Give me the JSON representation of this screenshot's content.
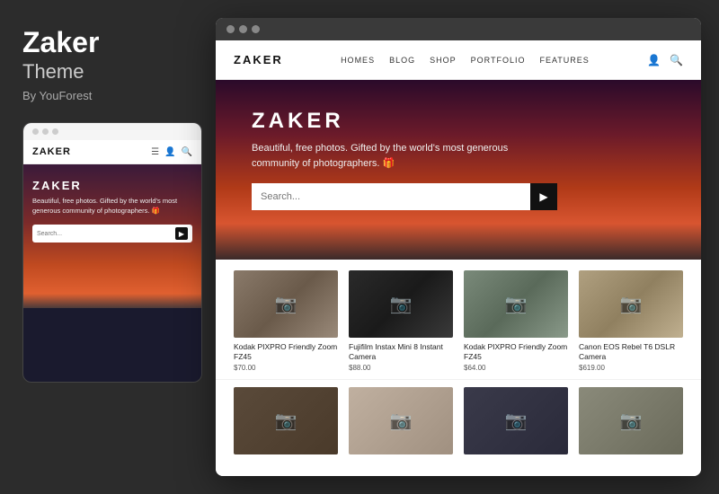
{
  "leftPanel": {
    "title": "Zaker",
    "subtitle": "Theme",
    "author": "By YouForest"
  },
  "mobileDots": [
    "dot1",
    "dot2",
    "dot3"
  ],
  "mobileNav": {
    "logo": "ZAKER",
    "icons": [
      "☰",
      "👤",
      "🔍"
    ]
  },
  "mobileHero": {
    "title": "ZAKER",
    "description": "Beautiful, free photos. Gifted by the world's most generous community of photographers. 🎁",
    "searchPlaceholder": "Search..."
  },
  "desktopDots": [
    "dot1",
    "dot2",
    "dot3"
  ],
  "desktopNav": {
    "logo": "ZAKER",
    "links": [
      "HOMES",
      "BLOG",
      "SHOP",
      "PORTFOLIO",
      "FEATURES"
    ]
  },
  "desktopHero": {
    "title": "ZAKER",
    "description": "Beautiful, free photos. Gifted by the world's most generous community of photographers. 🎁",
    "searchPlaceholder": "Search..."
  },
  "products": [
    {
      "name": "Kodak PIXPRO Friendly Zoom FZ45",
      "price": "$70.00",
      "camClass": "cam-1"
    },
    {
      "name": "Fujifilm Instax Mini 8 Instant Camera",
      "price": "$88.00",
      "camClass": "cam-2"
    },
    {
      "name": "Kodak PIXPRO Friendly Zoom FZ45",
      "price": "$64.00",
      "camClass": "cam-3"
    },
    {
      "name": "Canon EOS Rebel T6 DSLR Camera",
      "price": "$619.00",
      "camClass": "cam-4"
    }
  ],
  "products2": [
    {
      "camClass": "cam-5"
    },
    {
      "camClass": "cam-6"
    },
    {
      "camClass": "cam-7"
    },
    {
      "camClass": "cam-8"
    }
  ]
}
